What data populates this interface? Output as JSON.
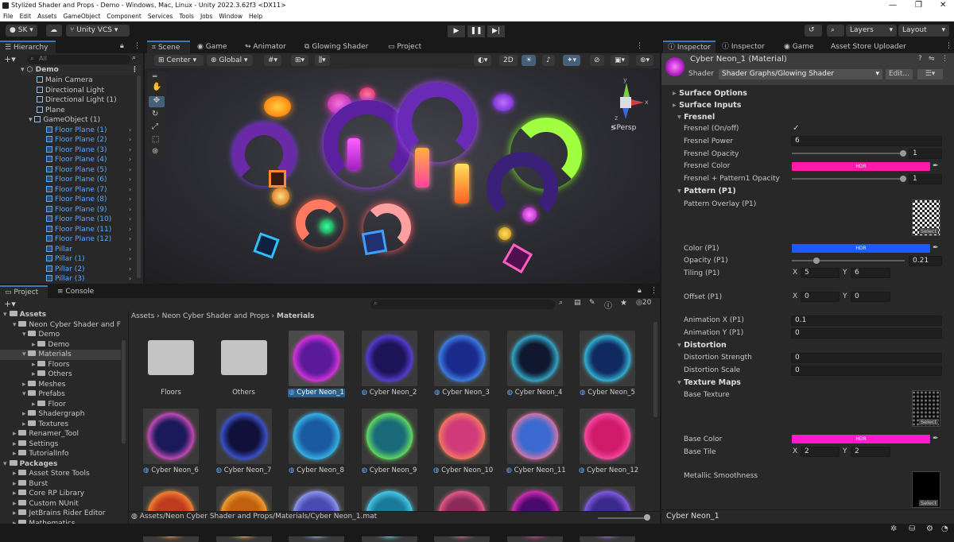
{
  "window": {
    "title": "Stylized Shader and Props - Demo - Windows, Mac, Linux - Unity 2022.3.62f3 <DX11>",
    "minimize": "—",
    "maximize": "❐",
    "close": "✕"
  },
  "menu": [
    "File",
    "Edit",
    "Assets",
    "GameObject",
    "Component",
    "Services",
    "Tools",
    "Jobs",
    "Window",
    "Help"
  ],
  "toolbar": {
    "account": "SK",
    "vcs": "Unity VCS",
    "layers": "Layers",
    "layout": "Layout"
  },
  "hierarchy": {
    "tab": "Hierarchy",
    "search_placeholder": "All",
    "scene": "Demo",
    "items": [
      {
        "label": "Main Camera",
        "blue": false,
        "indent": 2
      },
      {
        "label": "Directional Light",
        "blue": false,
        "indent": 2
      },
      {
        "label": "Directional Light (1)",
        "blue": false,
        "indent": 2
      },
      {
        "label": "Plane",
        "blue": false,
        "indent": 2
      },
      {
        "label": "GameObject (1)",
        "blue": false,
        "indent": 1
      },
      {
        "label": "Floor Plane (1)",
        "blue": true,
        "indent": 3
      },
      {
        "label": "Floor Plane (2)",
        "blue": true,
        "indent": 3
      },
      {
        "label": "Floor Plane (3)",
        "blue": true,
        "indent": 3
      },
      {
        "label": "Floor Plane (4)",
        "blue": true,
        "indent": 3
      },
      {
        "label": "Floor Plane (5)",
        "blue": true,
        "indent": 3
      },
      {
        "label": "Floor Plane (6)",
        "blue": true,
        "indent": 3
      },
      {
        "label": "Floor Plane (7)",
        "blue": true,
        "indent": 3
      },
      {
        "label": "Floor Plane (8)",
        "blue": true,
        "indent": 3
      },
      {
        "label": "Floor Plane (9)",
        "blue": true,
        "indent": 3
      },
      {
        "label": "Floor Plane (10)",
        "blue": true,
        "indent": 3
      },
      {
        "label": "Floor Plane (11)",
        "blue": true,
        "indent": 3
      },
      {
        "label": "Floor Plane (12)",
        "blue": true,
        "indent": 3
      },
      {
        "label": "Pillar",
        "blue": true,
        "indent": 3
      },
      {
        "label": "Pillar (1)",
        "blue": true,
        "indent": 3
      },
      {
        "label": "Pillar (2)",
        "blue": true,
        "indent": 3
      },
      {
        "label": "Pillar (3)",
        "blue": true,
        "indent": 3
      }
    ]
  },
  "scene_tabs": [
    "Scene",
    "Game",
    "Animator",
    "Glowing Shader",
    "Project"
  ],
  "scene_toolbar": {
    "pivot": "Center",
    "space": "Global",
    "mode2d": "2D"
  },
  "gizmo": {
    "x": "x",
    "y": "y",
    "z": "z",
    "persp": "Persp"
  },
  "project": {
    "tabs": [
      "Project",
      "Console"
    ],
    "count": "20",
    "tree": [
      {
        "label": "Assets",
        "bold": true,
        "indent": 0,
        "open": true
      },
      {
        "label": "Neon Cyber Shader and F",
        "indent": 1,
        "open": true
      },
      {
        "label": "Demo",
        "indent": 2,
        "open": true
      },
      {
        "label": "Demo",
        "indent": 3
      },
      {
        "label": "Materials",
        "indent": 2,
        "open": true,
        "selected": true
      },
      {
        "label": "Floors",
        "indent": 3
      },
      {
        "label": "Others",
        "indent": 3
      },
      {
        "label": "Meshes",
        "indent": 2
      },
      {
        "label": "Prefabs",
        "indent": 2,
        "open": true
      },
      {
        "label": "Floor",
        "indent": 3
      },
      {
        "label": "Shadergraph",
        "indent": 2
      },
      {
        "label": "Textures",
        "indent": 2
      },
      {
        "label": "Renamer_Tool",
        "indent": 1
      },
      {
        "label": "Settings",
        "indent": 1
      },
      {
        "label": "TutorialInfo",
        "indent": 1
      },
      {
        "label": "Packages",
        "bold": true,
        "indent": 0,
        "open": true
      },
      {
        "label": "Asset Store Tools",
        "indent": 1
      },
      {
        "label": "Burst",
        "indent": 1
      },
      {
        "label": "Core RP Library",
        "indent": 1
      },
      {
        "label": "Custom NUnit",
        "indent": 1
      },
      {
        "label": "JetBrains Rider Editor",
        "indent": 1
      },
      {
        "label": "Mathematics",
        "indent": 1
      }
    ],
    "breadcrumb": [
      "Assets",
      "Neon Cyber Shader and Props",
      "Materials"
    ],
    "assets": [
      {
        "label": "Floors",
        "type": "folder"
      },
      {
        "label": "Others",
        "type": "folder"
      },
      {
        "label": "Cyber Neon_1",
        "type": "mat",
        "c1": "#ff3cf0",
        "c2": "#5a1a9a",
        "selected": true
      },
      {
        "label": "Cyber Neon_2",
        "type": "mat",
        "c1": "#6a4aff",
        "c2": "#1c1456"
      },
      {
        "label": "Cyber Neon_3",
        "type": "mat",
        "c1": "#4a9aff",
        "c2": "#1a2a8a"
      },
      {
        "label": "Cyber Neon_4",
        "type": "mat",
        "c1": "#40d8ff",
        "c2": "#101830"
      },
      {
        "label": "Cyber Neon_5",
        "type": "mat",
        "c1": "#40e0ff",
        "c2": "#102a60"
      },
      {
        "label": "Cyber Neon_6",
        "type": "mat",
        "c1": "#ff5ad8",
        "c2": "#1a1a5a"
      },
      {
        "label": "Cyber Neon_7",
        "type": "mat",
        "c1": "#4a6aff",
        "c2": "#10103a"
      },
      {
        "label": "Cyber Neon_8",
        "type": "mat",
        "c1": "#40d0ff",
        "c2": "#1a5aa0"
      },
      {
        "label": "Cyber Neon_9",
        "type": "mat",
        "c1": "#7aff5a",
        "c2": "#1a6a7a"
      },
      {
        "label": "Cyber Neon_10",
        "type": "mat",
        "c1": "#ff8a5a",
        "c2": "#d03a7a"
      },
      {
        "label": "Cyber Neon_11",
        "type": "mat",
        "c1": "#ff7aa0",
        "c2": "#3a6ad0"
      },
      {
        "label": "Cyber Neon_12",
        "type": "mat",
        "c1": "#ff5ab0",
        "c2": "#d01a6a"
      },
      {
        "label": "",
        "type": "mat",
        "c1": "#ff9a3a",
        "c2": "#c03a20"
      },
      {
        "label": "",
        "type": "mat",
        "c1": "#ffb040",
        "c2": "#c06010"
      },
      {
        "label": "",
        "type": "mat",
        "c1": "#a0b0ff",
        "c2": "#4a4ab0"
      },
      {
        "label": "",
        "type": "mat",
        "c1": "#5ae0ff",
        "c2": "#1a7a9a"
      },
      {
        "label": "",
        "type": "mat",
        "c1": "#ff6a9a",
        "c2": "#8a2a5a"
      },
      {
        "label": "",
        "type": "mat",
        "c1": "#ff3ad0",
        "c2": "#4a0a6a"
      },
      {
        "label": "",
        "type": "mat",
        "c1": "#9a6aff",
        "c2": "#3a2a8a"
      }
    ],
    "status_path": "Assets/Neon Cyber Shader and Props/Materials/Cyber Neon_1.mat"
  },
  "inspector": {
    "tabs": [
      "Inspector",
      "Inspector",
      "Game",
      "Asset Store Uploader"
    ],
    "material_name": "Cyber Neon_1 (Material)",
    "shader_label": "Shader",
    "shader_value": "Shader Graphs/Glowing Shader",
    "edit_button": "Edit...",
    "sections": {
      "surface_options": "Surface Options",
      "surface_inputs": "Surface Inputs",
      "fresnel": "Fresnel",
      "pattern": "Pattern (P1)",
      "distortion": "Distortion",
      "texture_maps": "Texture Maps"
    },
    "props": {
      "fresnel_onoff": {
        "label": "Fresnel (On/off)",
        "value": "✓"
      },
      "fresnel_power": {
        "label": "Fresnel Power",
        "value": "6"
      },
      "fresnel_opacity": {
        "label": "Fresnel Opacity",
        "value": "1",
        "fraction": 1.0
      },
      "fresnel_color": {
        "label": "Fresnel Color",
        "hdr": "HDR",
        "color": "#ff1aa8"
      },
      "fresnel_pattern_opacity": {
        "label": "Fresnel + Pattern1 Opacity",
        "value": "1",
        "fraction": 1.0
      },
      "pattern_overlay": {
        "label": "Pattern Overlay (P1)",
        "select": "Select"
      },
      "color_p1": {
        "label": "Color (P1)",
        "hdr": "HDR",
        "color": "#1a5aff"
      },
      "opacity_p1": {
        "label": "Opacity (P1)",
        "value": "0.21",
        "fraction": 0.21
      },
      "tiling_p1": {
        "label": "Tiling (P1)",
        "x_label": "X",
        "x": "5",
        "y_label": "Y",
        "y": "6"
      },
      "offset_p1": {
        "label": "Offset (P1)",
        "x_label": "X",
        "x": "0",
        "y_label": "Y",
        "y": "0"
      },
      "anim_x": {
        "label": "Animation X (P1)",
        "value": "0.1"
      },
      "anim_y": {
        "label": "Animation Y (P1)",
        "value": "0"
      },
      "dist_strength": {
        "label": "Distortion Strength",
        "value": "0"
      },
      "dist_scale": {
        "label": "Distortion Scale",
        "value": "0"
      },
      "base_texture": {
        "label": "Base Texture",
        "select": "Select"
      },
      "base_color": {
        "label": "Base Color",
        "hdr": "HDR",
        "color": "#ff1ad0"
      },
      "base_tile": {
        "label": "Base Tile",
        "x_label": "X",
        "x": "2",
        "y_label": "Y",
        "y": "2"
      },
      "metallic": {
        "label": "Metallic Smoothness",
        "select": "Select"
      }
    },
    "footer": "Cyber Neon_1"
  }
}
